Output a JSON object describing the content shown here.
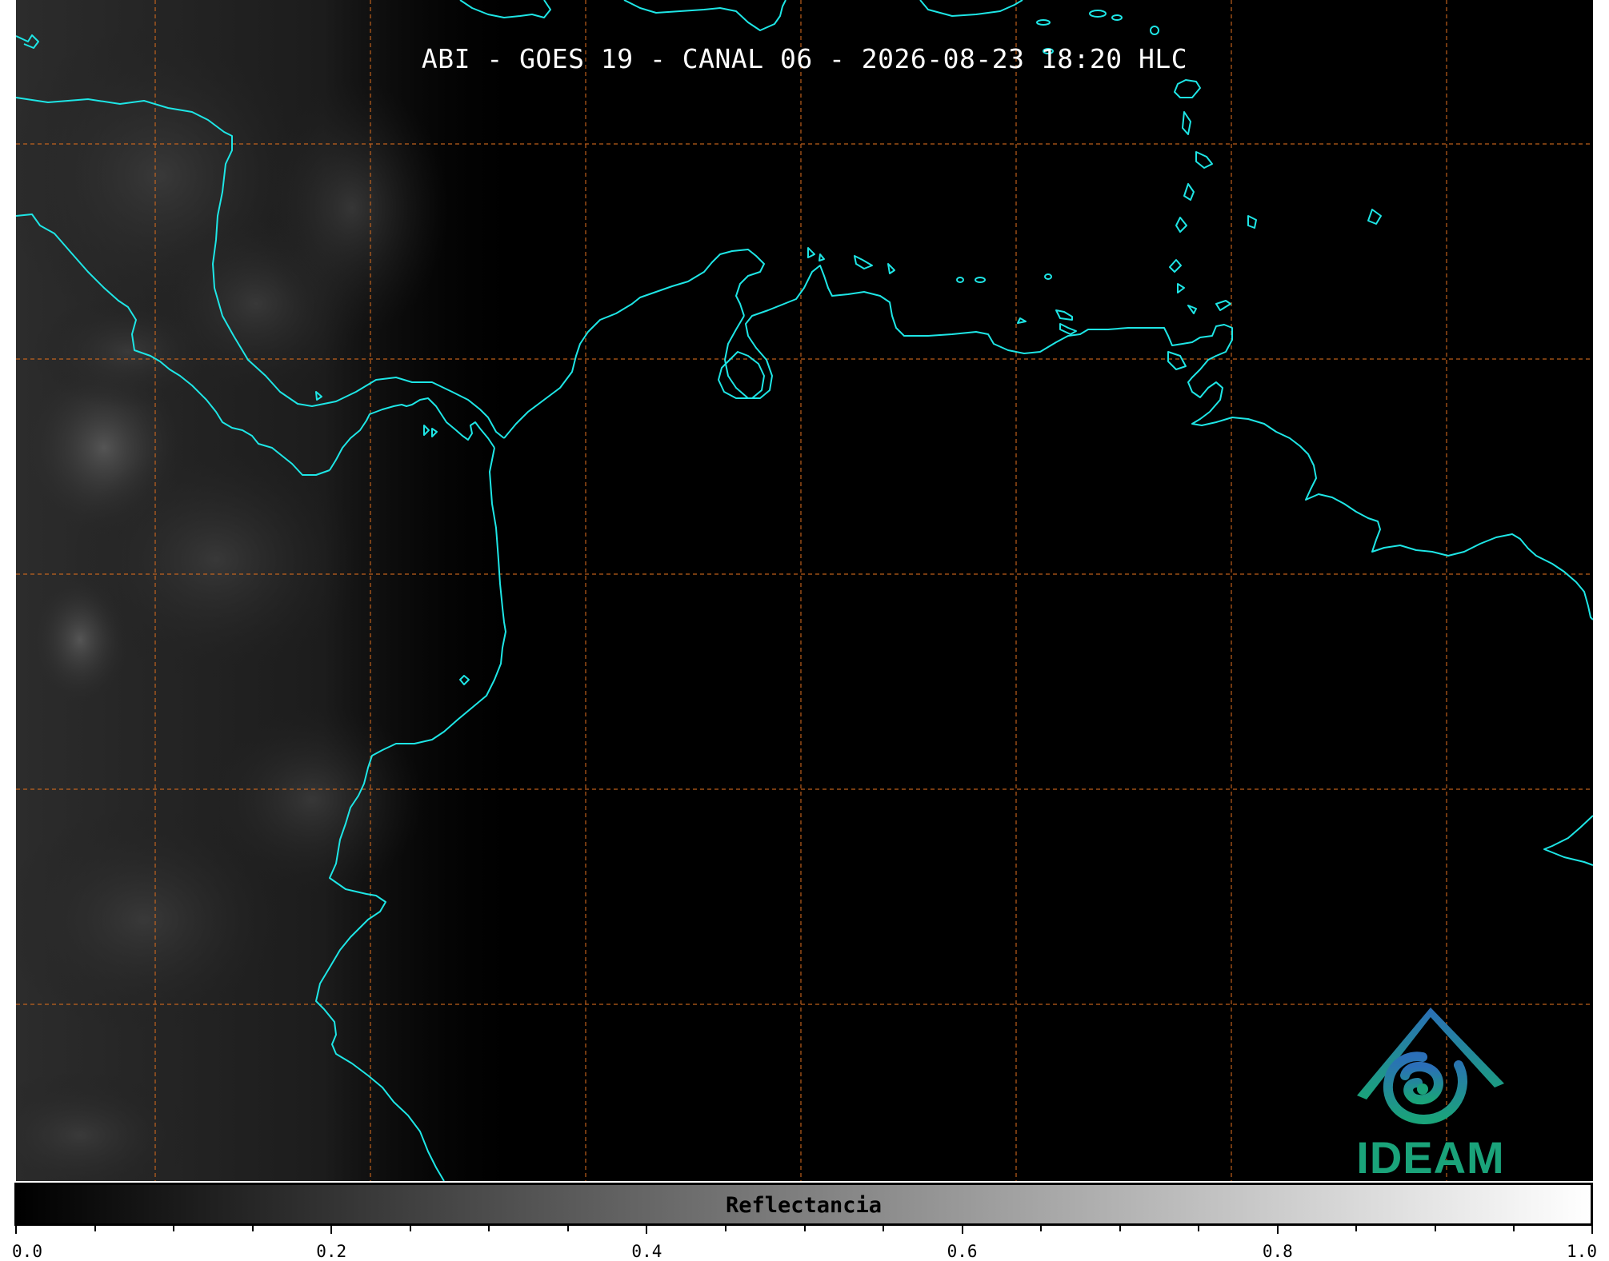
{
  "title": "ABI - GOES 19 - CANAL 06 - 2026-08-23 18:20 HLC",
  "logo": {
    "text": "IDEAM",
    "icon": "ideam-mountain-spiral-icon"
  },
  "colorbar": {
    "label": "Reflectancia",
    "range": [
      0.0,
      1.0
    ],
    "ticks": [
      "0.0",
      "0.2",
      "0.4",
      "0.6",
      "0.8",
      "1.0"
    ],
    "colormap": "grayscale black-to-white"
  },
  "colors": {
    "background": "#000000",
    "coastline": "#1ee6e6",
    "gridline": "#d2691e",
    "logo_blue": "#2b6fb8",
    "logo_green": "#1aa37a"
  },
  "map": {
    "gridlines": "dashed orange",
    "coastlines": "cyan",
    "region": "Caribbean and northern South America"
  }
}
